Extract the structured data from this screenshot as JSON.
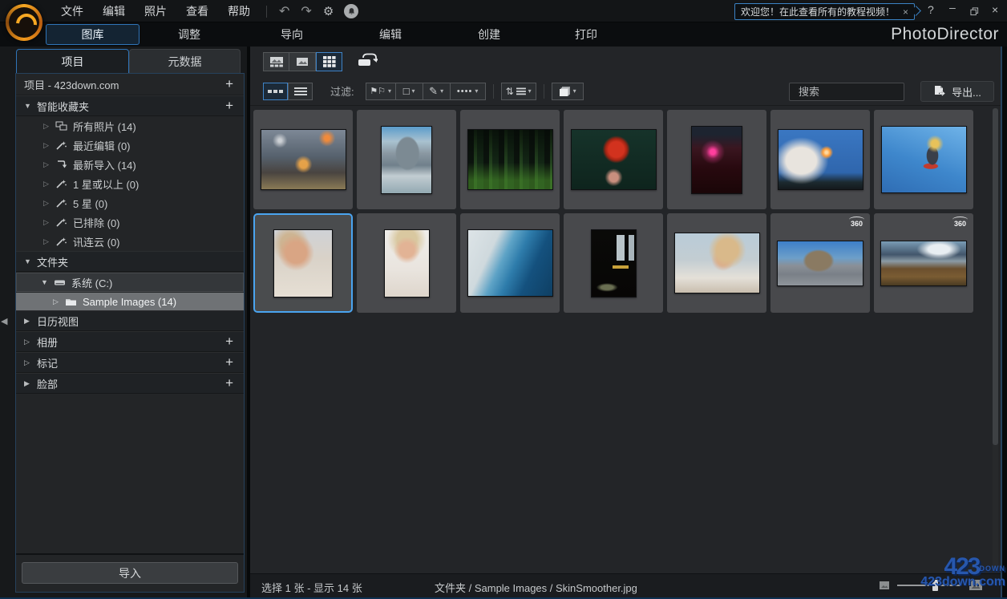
{
  "app": {
    "title": "PhotoDirector"
  },
  "colors": {
    "accent_blue": "#3f83c6",
    "selection_blue": "#4aa4f0",
    "watermark_blue": "#2757ad",
    "panel_bg": "#232527",
    "card_bg": "#48494c",
    "titlebar_bg": "#131517"
  },
  "menu": {
    "items": [
      "文件",
      "编辑",
      "照片",
      "查看",
      "帮助"
    ]
  },
  "titlebar": {
    "notification": {
      "text": "欢迎您！在此查看所有的教程视频！",
      "close": "×"
    },
    "help": "?",
    "minimize": "—",
    "close": "×"
  },
  "tabs": [
    {
      "label": "图库",
      "active": true
    },
    {
      "label": "调整",
      "active": false
    },
    {
      "label": "导向",
      "active": false
    },
    {
      "label": "编辑",
      "active": false
    },
    {
      "label": "创建",
      "active": false
    },
    {
      "label": "打印",
      "active": false
    }
  ],
  "sidebar": {
    "tabs": [
      {
        "label": "项目",
        "active": true
      },
      {
        "label": "元数据",
        "active": false
      }
    ],
    "header": {
      "label": "项目 - 423down.com",
      "add": "+"
    },
    "smart": {
      "label": "智能收藏夹",
      "add": "+",
      "items": [
        {
          "icon": "all-photos",
          "label": "所有照片 (14)"
        },
        {
          "icon": "magic-wand",
          "label": "最近编辑 (0)"
        },
        {
          "icon": "import-arrow",
          "label": "最新导入 (14)"
        },
        {
          "icon": "magic-wand",
          "label": "1 星或以上 (0)"
        },
        {
          "icon": "magic-wand",
          "label": "5 星 (0)"
        },
        {
          "icon": "magic-wand",
          "label": "已排除 (0)"
        },
        {
          "icon": "magic-wand",
          "label": "讯连云 (0)"
        }
      ]
    },
    "folders": {
      "label": "文件夹",
      "drive": "系统 (C:)",
      "folder": "Sample Images (14)"
    },
    "calendar": {
      "label": "日历视图"
    },
    "albums": {
      "label": "相册",
      "add": "+"
    },
    "tags": {
      "label": "标记",
      "add": "+"
    },
    "faces": {
      "label": "脸部",
      "add": "+"
    },
    "import_button": "导入"
  },
  "toolbar": {
    "filter_label": "过滤:"
  },
  "search": {
    "placeholder": "搜索",
    "clear": "×"
  },
  "export_label": "导出...",
  "status": {
    "selection": "选择 1 张 - 显示 14 张",
    "path": "文件夹 / Sample Images / SkinSmoother.jpg"
  },
  "watermark": {
    "line1": "423",
    "line1b": "DOWN",
    "line2": "423down.com"
  },
  "photos": [
    {
      "name": "basketball-dunk",
      "kind": "landscape",
      "selected": false,
      "badge": null,
      "bg": "radial-gradient(circle at 78% 14%, rgba(255,140,50,0.9) 3%, transparent 10%), radial-gradient(circle at 50% 58%, rgba(255,175,70,0.85) 7%, transparent 16%), radial-gradient(circle at 22% 18%, rgba(255,255,255,0.65) 2%, transparent 9%), linear-gradient(180deg,#7d8896 0%,#56616d 45%,#494440 72%,#8a7a55 100%)"
    },
    {
      "name": "boat-cliff",
      "kind": "portrait",
      "selected": false,
      "badge": null,
      "bg": "radial-gradient(ellipse 40% 42% at 52% 40%, #7c8a93 55%, transparent 62%), linear-gradient(180deg,#5b9ccb 0%,#a9c2d0 22%,#8a98a2 40%,#70808b 58%,#c2cdd2 74%,#93a9b2 100%)"
    },
    {
      "name": "forest",
      "kind": "landscape",
      "selected": false,
      "badge": null,
      "bg": "linear-gradient(180deg, rgba(5,10,6,0.75) 0%, rgba(5,10,6,0) 55%, rgba(76,150,44,0.55) 85%), repeating-linear-gradient(90deg,#0b130d 0px,#0b130d 7px,#22401e 7px,#22401e 11px,#132615 11px,#132615 19px)"
    },
    {
      "name": "maple-leaf",
      "kind": "landscape",
      "selected": false,
      "badge": null,
      "bg": "radial-gradient(circle at 50% 80%, #c98f7e 7%, transparent 14%), radial-gradient(circle at 53% 33%, #d2321e 13%, #a02413 18%, transparent 23%), linear-gradient(180deg,#16332a,#0e241d)"
    },
    {
      "name": "neon-sign",
      "kind": "portrait",
      "selected": false,
      "badge": null,
      "bg": "radial-gradient(circle at 42% 38%, #ff3f9e 5%, rgba(255,63,158,0.35) 13%, transparent 24%), linear-gradient(180deg,#1d2430 12%, #3a1620 32%, #28090f 62%, #1a0608 100%)"
    },
    {
      "name": "rocket-launch",
      "kind": "landscape",
      "selected": false,
      "badge": null,
      "bg": "radial-gradient(circle at 57% 38%, #ffd9a0 2%, #ff9e3a 6%, transparent 11%), radial-gradient(ellipse 45% 55% at 27% 52%, #e8e4de 40%, rgba(232,228,222,0) 72%), linear-gradient(180deg,#3a77c2 0%,#2f66ad 72%,#1c2a30 88%,#14191c 100%)"
    },
    {
      "name": "skateboarder",
      "kind": "landscape-tall",
      "selected": false,
      "badge": null,
      "bg": "radial-gradient(circle at 63% 26%, #e8c25a 5%, transparent 12%), radial-gradient(ellipse 11% 22% at 60% 44%, #3a3f4a 60%, transparent 66%), radial-gradient(ellipse 14% 7% at 58% 60%, #c23b2e 58%, transparent 66%), linear-gradient(200deg,#6fb3e8 0%,#3e87cc 55%,#2f6db4 100%)"
    },
    {
      "name": "woman-smiling",
      "kind": "portrait-wide",
      "selected": true,
      "badge": null,
      "bg": "radial-gradient(circle at 38% 34%, #d9a584 18%, transparent 32%), radial-gradient(circle at 28% 20%, #cdb492 14%, transparent 28%), linear-gradient(180deg,#cfd2d6 0%,#d9d2c8 42%,#e6dfd4 100%)"
    },
    {
      "name": "woman-laughing",
      "kind": "portrait-narrow",
      "selected": false,
      "badge": null,
      "bg": "radial-gradient(circle at 50% 30%, #e2b395 14%, transparent 26%), radial-gradient(circle at 50% 14%, #d9c8a0 16%, transparent 32%), linear-gradient(180deg,#efedea 0%,#e9e4de 60%,#ded6cc 100%)"
    },
    {
      "name": "ocean-wave",
      "kind": "landscape-tall",
      "selected": false,
      "badge": null,
      "bg": "linear-gradient(115deg,#dde4e7 0%,#cfd9dd 28%,#5ea3c6 42%,#2e7cab 55%,#14517e 72%,#0f3f63 100%)"
    },
    {
      "name": "dark-window",
      "kind": "portrait-narrow",
      "selected": false,
      "badge": null,
      "bg": "linear-gradient(#b9c4c9,#b9c4c9) 70% 6px/10px 32px no-repeat, linear-gradient(#a8b4ba,#a8b4ba) 96% 6px/7px 32px no-repeat, linear-gradient(#c9a23a,#c9a23a) 76% 44px/20px 4px no-repeat, radial-gradient(ellipse 34% 9% at 35% 86%, #6a6f52 40%, transparent 72%), linear-gradient(180deg,#0a0a08,#070605)"
    },
    {
      "name": "woman-leaning",
      "kind": "landscape",
      "selected": false,
      "badge": null,
      "bg": "radial-gradient(circle at 62% 28%, #d9b98a 16%, transparent 28%), radial-gradient(circle at 57% 44%, #dcab8c 10%, transparent 20%), linear-gradient(180deg,#b9ccd8 0%,#c3cdd2 45%,#e4e0d8 75%,#c9beae 100%)"
    },
    {
      "name": "pano-canyon",
      "kind": "pano",
      "selected": false,
      "badge": "360",
      "bg": "radial-gradient(ellipse 30% 42% at 48% 44%, #8a7a62 50%, transparent 62%), linear-gradient(180deg,#3d7fc9 0%,#6d9fc9 38%,#8a9098 55%,#7a8087 75%,#8f959b 100%)"
    },
    {
      "name": "pano-desert",
      "kind": "pano",
      "selected": false,
      "badge": "360",
      "bg": "radial-gradient(ellipse 42% 36% at 68% 18%, #e8eef2 30%, transparent 62%), linear-gradient(180deg,#7a9cb5 0%,#42566b 30%,#8a9aa5 45%,#6b4f2e 62%,#7a5c33 80%,#4a3a22 100%)"
    }
  ]
}
